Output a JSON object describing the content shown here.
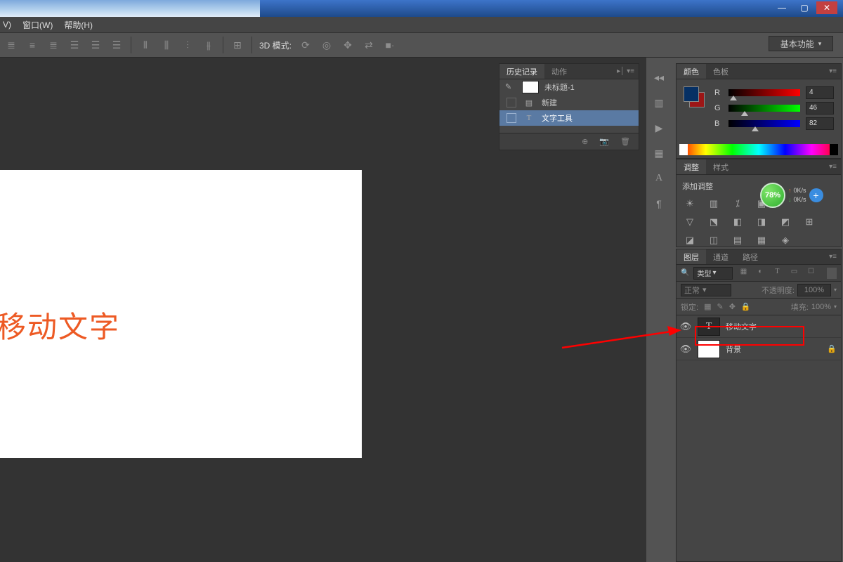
{
  "window": {
    "minimize": "—",
    "maximize": "▢",
    "close": "✕"
  },
  "menubar": {
    "item1": "V)",
    "item2": "窗口(W)",
    "item3": "帮助(H)"
  },
  "optbar": {
    "mode3d_label": "3D 模式:",
    "workspace": "基本功能"
  },
  "canvas": {
    "text": "移动文字"
  },
  "history": {
    "tab_history": "历史记录",
    "tab_actions": "动作",
    "doc_name": "未标题-1",
    "steps": [
      {
        "icon": "▤",
        "label": "新建"
      },
      {
        "icon": "T",
        "label": "文字工具"
      }
    ]
  },
  "colors": {
    "tab_color": "颜色",
    "tab_swatches": "色板",
    "channels": [
      {
        "lab": "R",
        "val": "4",
        "grad": "linear-gradient(to right,#000,#f00)",
        "pos": "2%"
      },
      {
        "lab": "G",
        "val": "46",
        "grad": "linear-gradient(to right,#000,#0f0)",
        "pos": "18%"
      },
      {
        "lab": "B",
        "val": "82",
        "grad": "linear-gradient(to right,#000,#00f)",
        "pos": "32%"
      }
    ]
  },
  "adjust": {
    "tab_adjust": "调整",
    "tab_styles": "样式",
    "heading": "添加调整"
  },
  "netspeed": {
    "percent": "78%",
    "up": "0K/s",
    "down": "0K/s"
  },
  "layers": {
    "tab_layers": "图层",
    "tab_channels": "通道",
    "tab_paths": "路径",
    "filter_type": "类型",
    "blend_mode": "正常",
    "opacity_label": "不透明度:",
    "opacity_val": "100%",
    "lock_label": "锁定:",
    "fill_label": "填充:",
    "fill_val": "100%",
    "rows": [
      {
        "name": "移动文字",
        "thumb": "T"
      },
      {
        "name": "背景",
        "thumb": ""
      }
    ]
  }
}
